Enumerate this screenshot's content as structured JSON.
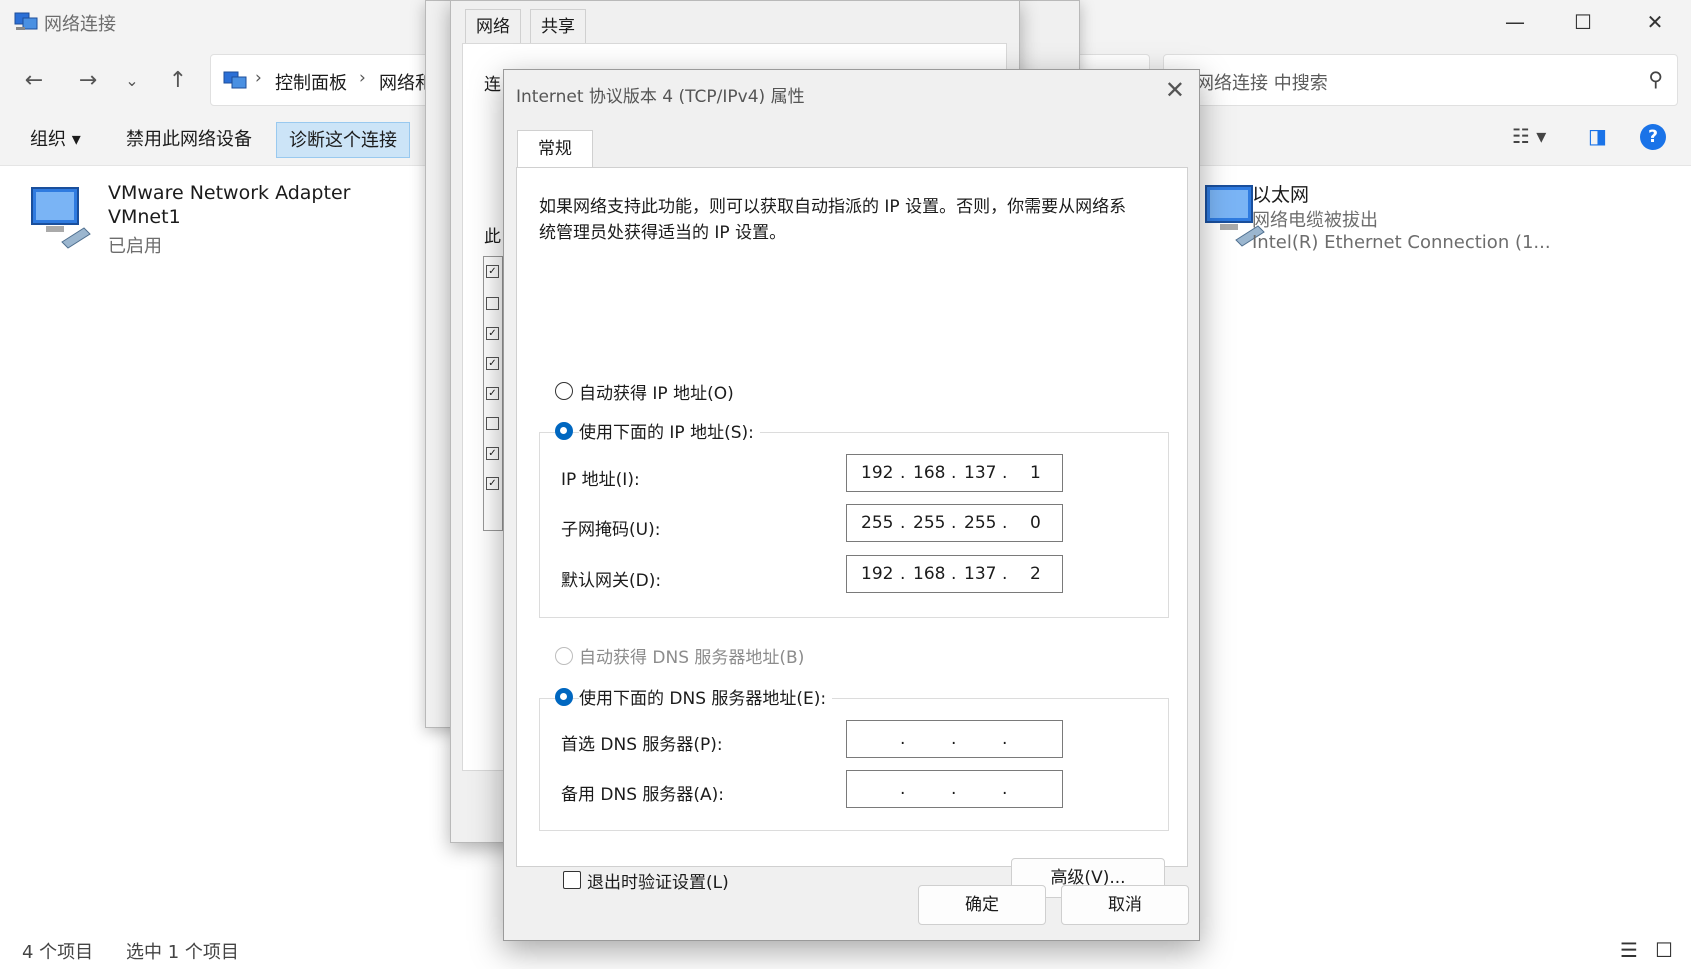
{
  "explorer": {
    "title": "网络连接",
    "breadcrumb": [
      "控制面板",
      "网络和"
    ],
    "search_placeholder": "网络连接 中搜索",
    "commands": {
      "organize": "组织 ▾",
      "disable": "禁用此网络设备",
      "diagnose": "诊断这个连接"
    },
    "items": [
      {
        "name": "VMware Network Adapter",
        "name2": "VMnet1",
        "status": "已启用"
      },
      {
        "name": "以太网",
        "status": "网络电缆被拔出",
        "device": "Intel(R) Ethernet Connection (1..."
      }
    ],
    "status": {
      "count": "4 个项目",
      "selected": "选中 1 个项目"
    }
  },
  "props": {
    "tabs": [
      "网络",
      "共享"
    ],
    "fragments": [
      "连",
      "此"
    ]
  },
  "dialog": {
    "title": "Internet 协议版本 4 (TCP/IPv4) 属性",
    "tab": "常规",
    "description": "如果网络支持此功能，则可以获取自动指派的 IP 设置。否则，你需要从网络系统管理员处获得适当的 IP 设置。",
    "auto_ip": "自动获得 IP 地址(O)",
    "manual_ip": "使用下面的 IP 地址(S):",
    "ip_label": "IP 地址(I):",
    "mask_label": "子网掩码(U):",
    "gateway_label": "默认网关(D):",
    "ip": [
      "192",
      "168",
      "137",
      "1"
    ],
    "mask": [
      "255",
      "255",
      "255",
      "0"
    ],
    "gateway": [
      "192",
      "168",
      "137",
      "2"
    ],
    "auto_dns": "自动获得 DNS 服务器地址(B)",
    "manual_dns": "使用下面的 DNS 服务器地址(E):",
    "dns1_label": "首选 DNS 服务器(P):",
    "dns2_label": "备用 DNS 服务器(A):",
    "validate": "退出时验证设置(L)",
    "advanced": "高级(V)...",
    "ok": "确定",
    "cancel": "取消",
    "dot": "."
  }
}
